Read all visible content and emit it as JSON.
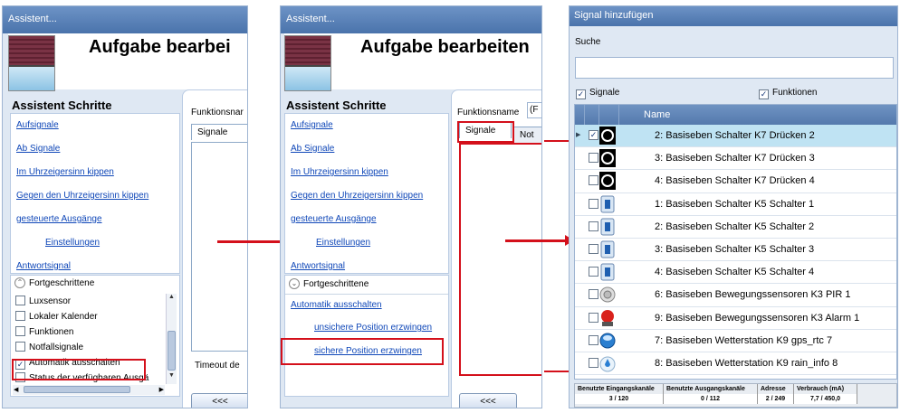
{
  "p1": {
    "title": "Assistent...",
    "heading": "Aufgabe bearbei",
    "steps_title": "Assistent Schritte",
    "steps": [
      "Aufsignale",
      "Ab Signale",
      "Im Uhrzeigersinn kippen",
      "Gegen den Uhrzeigersinn kippen",
      "gesteuerte Ausgänge",
      "Einstellungen",
      "Antwortsignal"
    ],
    "advanced": "Fortgeschrittene",
    "adv_items": [
      {
        "label": "Luxsensor",
        "checked": false
      },
      {
        "label": "Lokaler Kalender",
        "checked": false
      },
      {
        "label": "Funktionen",
        "checked": false
      },
      {
        "label": "Notfallsignale",
        "checked": false
      },
      {
        "label": "Automatik ausschalten",
        "checked": true
      },
      {
        "label": "Status der verfügbaren Ausgä",
        "checked": false
      }
    ],
    "funk_label": "Funktionsnar",
    "tab": "Signale",
    "timeout": "Timeout de",
    "back": "<<<"
  },
  "p2": {
    "title": "Assistent...",
    "heading": "Aufgabe bearbeiten",
    "steps_title": "Assistent Schritte",
    "steps": [
      "Aufsignale",
      "Ab Signale",
      "Im Uhrzeigersinn kippen",
      "Gegen den Uhrzeigersinn kippen",
      "gesteuerte Ausgänge",
      "Einstellungen",
      "Antwortsignal"
    ],
    "advanced": "Fortgeschrittene",
    "adv_links": [
      "Automatik ausschalten",
      "unsichere Position erzwingen",
      "sichere Position erzwingen"
    ],
    "funk_label": "Funktionsname",
    "funk_value": "(F",
    "tab1": "Signale",
    "tab2": "Not",
    "back": "<<<"
  },
  "p3": {
    "title": "Signal hinzufügen",
    "search_label": "Suche",
    "signals_label": "Signale",
    "functions_label": "Funktionen",
    "col_name": "Name",
    "rows": [
      {
        "name": "2: Basiseben Schalter K7 Drücken 2",
        "icon": "push-button-icon",
        "checked": true,
        "selected": true
      },
      {
        "name": "3: Basiseben Schalter K7 Drücken 3",
        "icon": "push-button-icon",
        "checked": false
      },
      {
        "name": "4: Basiseben Schalter K7 Drücken 4",
        "icon": "push-button-icon",
        "checked": false
      },
      {
        "name": "1: Basiseben Schalter K5 Schalter 1",
        "icon": "switch-icon",
        "checked": false
      },
      {
        "name": "2: Basiseben Schalter K5 Schalter 2",
        "icon": "switch-icon",
        "checked": false
      },
      {
        "name": "3: Basiseben Schalter K5 Schalter 3",
        "icon": "switch-icon",
        "checked": false
      },
      {
        "name": "4: Basiseben Schalter K5 Schalter 4",
        "icon": "switch-icon",
        "checked": false
      },
      {
        "name": "6: Basiseben Bewegungssensoren K3 PIR 1",
        "icon": "pir-sensor-icon",
        "checked": false
      },
      {
        "name": "9: Basiseben Bewegungssensoren K3 Alarm 1",
        "icon": "alarm-icon",
        "checked": false
      },
      {
        "name": "7: Basiseben Wetterstation K9 gps_rtc 7",
        "icon": "weather-icon",
        "checked": false
      },
      {
        "name": "8: Basiseben Wetterstation K9 rain_info 8",
        "icon": "rain-icon",
        "checked": false
      }
    ],
    "stats": {
      "in_label": "Benutzte Eingangskanäle",
      "in_value": "3 / 120",
      "out_label": "Benutzte Ausgangskanäle",
      "out_value": "0 / 112",
      "addr_label": "Adresse",
      "addr_value": "2 / 249",
      "cons_label": "Verbrauch (mA)",
      "cons_value": "7,7 / 450,0"
    }
  },
  "colors": {
    "accent": "#d4101b",
    "link": "#0f47b8",
    "titlebar": "#5a80b8",
    "selected_row": "#bfe3f3"
  }
}
